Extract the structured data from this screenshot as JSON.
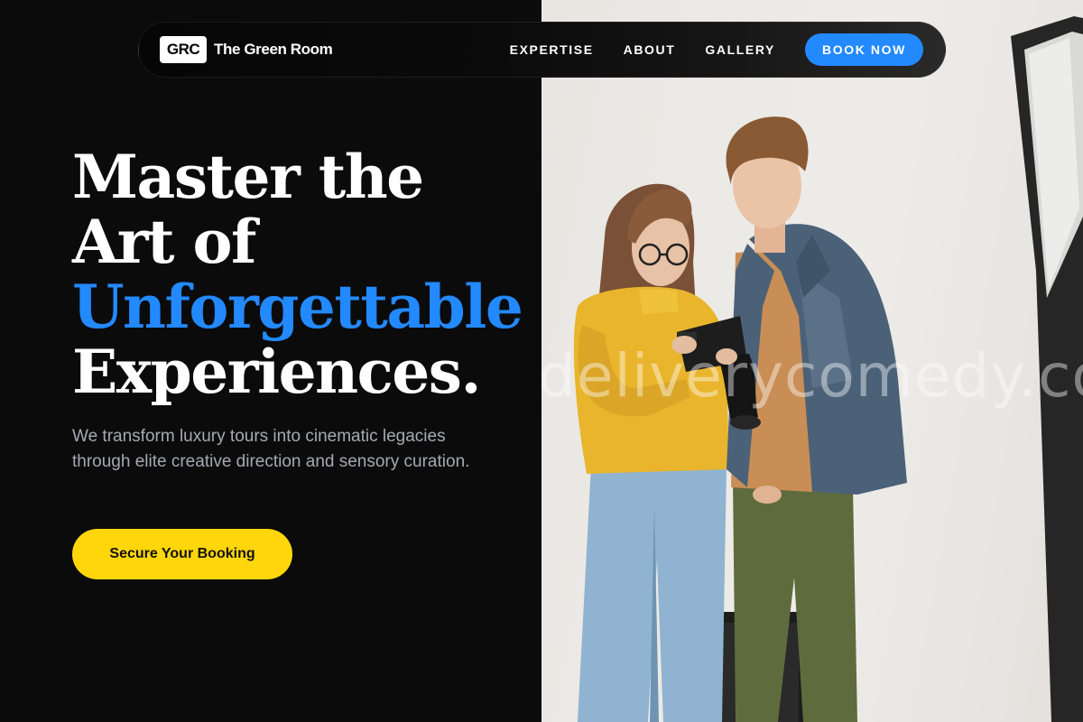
{
  "nav": {
    "logo_mark": "GRC",
    "brand_name": "The Green Room",
    "links": [
      "EXPERTISE",
      "ABOUT",
      "GALLERY"
    ],
    "cta_label": "BOOK NOW"
  },
  "hero": {
    "headline_line1": "Master the",
    "headline_line2": "Art of",
    "headline_accent": "Unforgettable",
    "headline_line4": "Experiences.",
    "subtext": "We transform luxury tours into cinematic legacies through elite creative direction and sensory curation.",
    "cta_label": "Secure Your Booking"
  },
  "photo": {
    "watermark": "deliverycomedy.com"
  },
  "colors": {
    "accent_blue": "#2389ff",
    "cta_yellow": "#ffd60a",
    "background": "#0b0b0c",
    "subtext_gray": "#a6a9b2"
  }
}
